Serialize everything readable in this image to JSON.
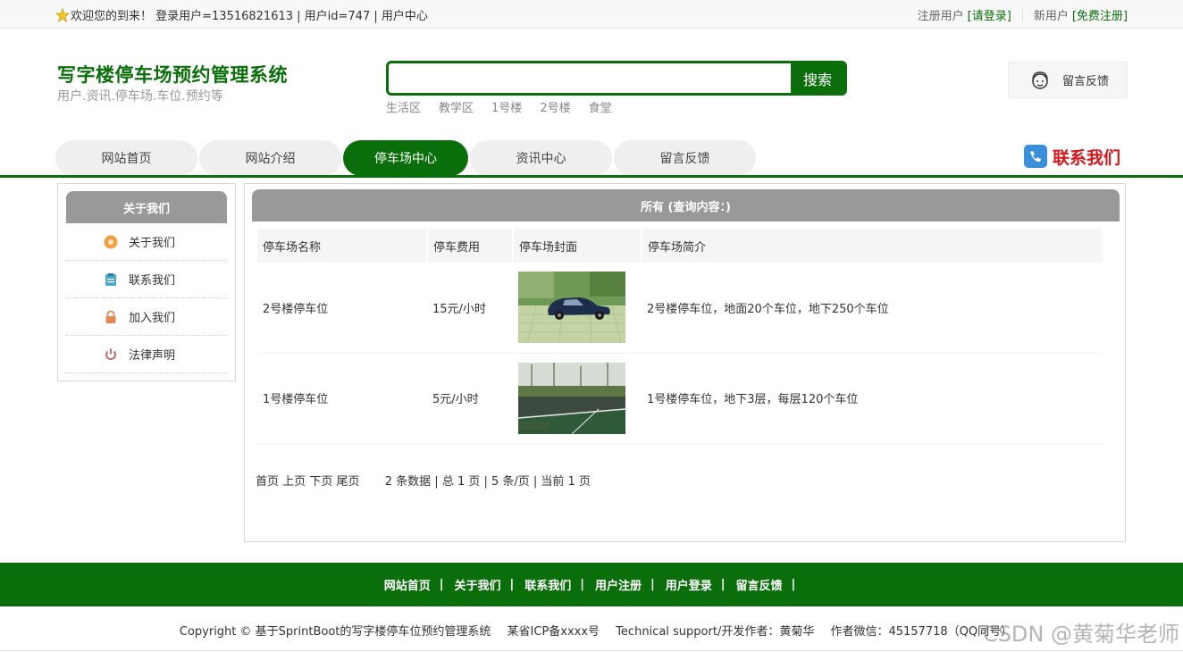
{
  "topbar": {
    "welcome": "欢迎您的到来！ 登录用户=13516821613 | 用户id=747 | 用户中心",
    "register_prefix": "注册用户",
    "login_link": "[请登录]",
    "new_user_prefix": "新用户",
    "free_register_link": "[免费注册]"
  },
  "header": {
    "title": "写字楼停车场预约管理系统",
    "subtitle": "用户.资讯.停车场.车位.预约等",
    "search_placeholder": "",
    "search_button": "搜索",
    "hotwords": [
      "生活区",
      "教学区",
      "1号楼",
      "2号楼",
      "食堂"
    ],
    "feedback_label": "留言反馈"
  },
  "nav": {
    "items": [
      "网站首页",
      "网站介绍",
      "停车场中心",
      "资讯中心",
      "留言反馈"
    ],
    "active_index": 2,
    "contact_label": "联系我们"
  },
  "sidebar": {
    "title": "关于我们",
    "items": [
      {
        "label": "关于我们",
        "icon": "info-icon",
        "color": "#f0a040"
      },
      {
        "label": "联系我们",
        "icon": "clipboard-icon",
        "color": "#4aa8c8"
      },
      {
        "label": "加入我们",
        "icon": "lock-icon",
        "color": "#e0885a"
      },
      {
        "label": "法律声明",
        "icon": "power-icon",
        "color": "#c07070"
      }
    ]
  },
  "main": {
    "title": "所有 (查询内容：)",
    "columns": [
      "停车场名称",
      "停车费用",
      "停车场封面",
      "停车场简介"
    ],
    "rows": [
      {
        "name": "2号楼停车位",
        "fee": "15元/小时",
        "cover": "parking-lot-car-image",
        "intro": "2号楼停车位，地面20个车位，地下250个车位"
      },
      {
        "name": "1号楼停车位",
        "fee": "5元/小时",
        "cover": "parking-lot-road-image",
        "intro": "1号楼停车位，地下3层，每层120个车位"
      }
    ],
    "pager": {
      "first": "首页",
      "prev": "上页",
      "next": "下页",
      "last": "尾页",
      "summary": "2 条数据 | 总 1 页 | 5 条/页 | 当前 1 页"
    }
  },
  "footer": {
    "links": [
      "网站首页",
      "关于我们",
      "联系我们",
      "用户注册",
      "用户登录",
      "留言反馈"
    ],
    "copyright": "Copyright © 基于SprintBoot的写字楼停车位预约管理系统",
    "icp": "某省ICP备xxxx号",
    "support": "Technical support/开发作者：黄菊华",
    "wechat": "作者微信：45157718（QQ同号）",
    "watermark": "CSDN @黄菊华老师"
  },
  "colors": {
    "brand_green": "#0a6f0a",
    "contact_red": "#d7161b",
    "panel_gray": "#999999"
  }
}
